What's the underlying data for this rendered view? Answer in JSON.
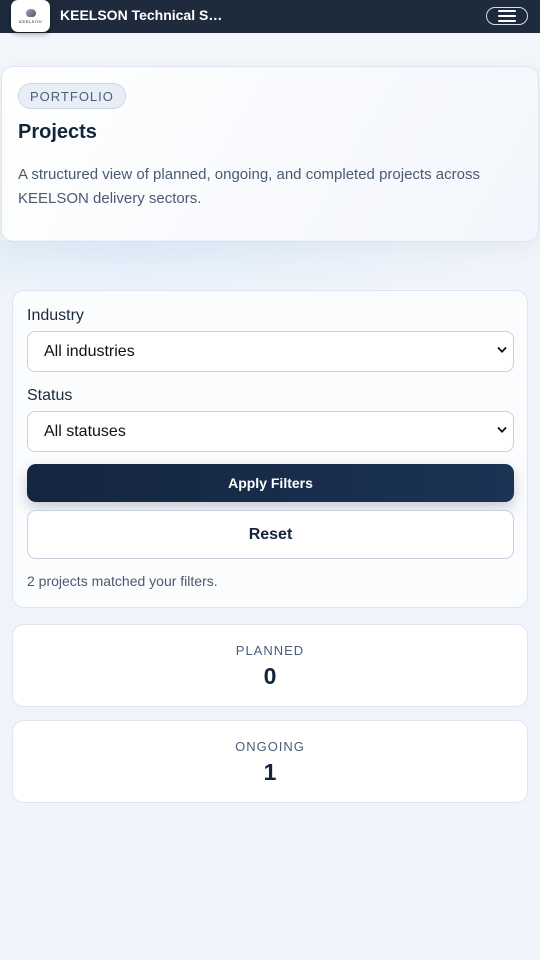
{
  "header": {
    "brand": "KEELSON Technical Se...",
    "logo_text": "KEELSON"
  },
  "hero": {
    "chip": "PORTFOLIO",
    "title": "Projects",
    "description": "A structured view of planned, ongoing, and completed projects across KEELSON delivery sectors."
  },
  "filters": {
    "industry_label": "Industry",
    "industry_value": "All industries",
    "status_label": "Status",
    "status_value": "All statuses",
    "apply_label": "Apply Filters",
    "reset_label": "Reset",
    "match_text": "2 projects matched your filters."
  },
  "stats": [
    {
      "label": "PLANNED",
      "value": "0"
    },
    {
      "label": "ONGOING",
      "value": "1"
    }
  ],
  "colors": {
    "topbar": "#1e2b3c",
    "primary": "#142540",
    "text": "#13243b",
    "muted": "#4a5a70"
  }
}
